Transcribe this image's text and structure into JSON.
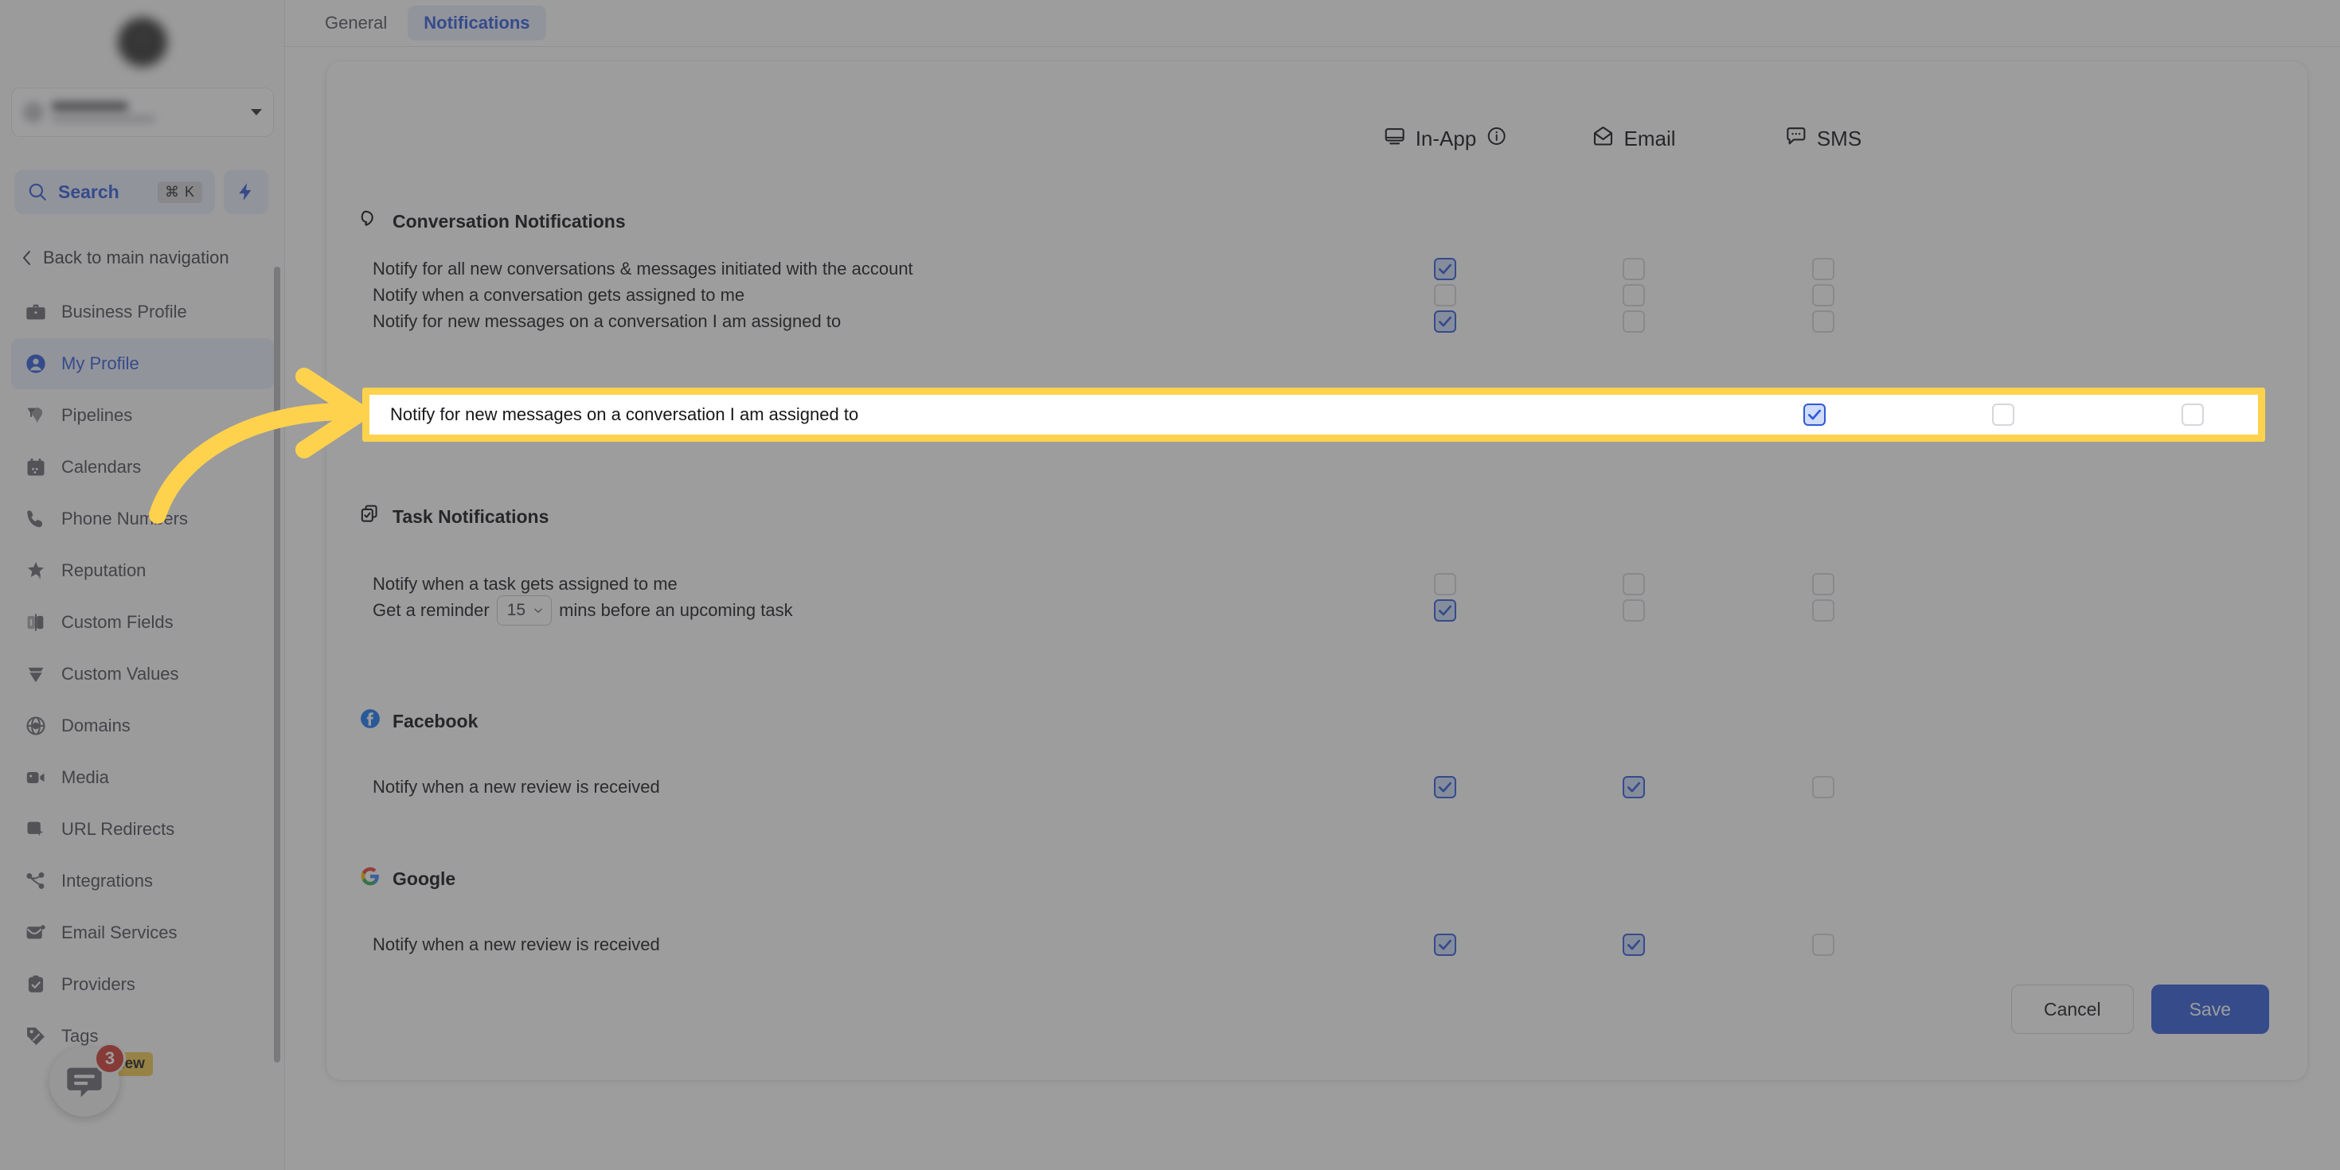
{
  "sidebar": {
    "account_switcher": {
      "name_hidden": true
    },
    "search": {
      "label": "Search",
      "shortcut": "⌘ K"
    },
    "back_nav": {
      "label": "Back to main navigation",
      "icon": "chevron-left-icon"
    },
    "items": [
      {
        "label": "Business Profile",
        "icon": "briefcase-icon",
        "active": false
      },
      {
        "label": "My Profile",
        "icon": "user-circle-icon",
        "active": true
      },
      {
        "label": "Pipelines",
        "icon": "funnel-icon",
        "active": false
      },
      {
        "label": "Calendars",
        "icon": "calendar-icon",
        "active": false
      },
      {
        "label": "Phone Numbers",
        "icon": "phone-icon",
        "active": false
      },
      {
        "label": "Reputation",
        "icon": "star-icon",
        "active": false
      },
      {
        "label": "Custom Fields",
        "icon": "custom-fields-icon",
        "active": false
      },
      {
        "label": "Custom Values",
        "icon": "diamond-icon",
        "active": false
      },
      {
        "label": "Domains",
        "icon": "globe-icon",
        "active": false
      },
      {
        "label": "Media",
        "icon": "video-icon",
        "active": false
      },
      {
        "label": "URL Redirects",
        "icon": "cursor-box-icon",
        "active": false
      },
      {
        "label": "Integrations",
        "icon": "share-nodes-icon",
        "active": false
      },
      {
        "label": "Email Services",
        "icon": "envelope-icon",
        "active": false
      },
      {
        "label": "Providers",
        "icon": "clipboard-check-icon",
        "active": false
      },
      {
        "label": "Tags",
        "icon": "tag-icon",
        "active": false
      }
    ],
    "chat_widget": {
      "count": "3",
      "new_label": "new",
      "icon": "chat-bubble-icon"
    }
  },
  "tabs": [
    {
      "label": "General",
      "active": false
    },
    {
      "label": "Notifications",
      "active": true
    }
  ],
  "columns": [
    {
      "label": "In-App",
      "icon": "monitor-icon",
      "info_icon": "info-circle-icon"
    },
    {
      "label": "Email",
      "icon": "envelope-open-icon"
    },
    {
      "label": "SMS",
      "icon": "sms-bubble-icon"
    }
  ],
  "sections": [
    {
      "title": "Conversation Notifications",
      "icon": "speech-bubble-icon",
      "rows": [
        {
          "label": "Notify for all new conversations & messages initiated with the account",
          "in_app": true,
          "email": false,
          "sms": false
        },
        {
          "label": "Notify when a conversation gets assigned to me",
          "in_app": false,
          "email": false,
          "sms": false
        },
        {
          "label": "Notify for new messages on a conversation I am assigned to",
          "in_app": true,
          "email": false,
          "sms": false,
          "highlighted": true
        }
      ]
    },
    {
      "title": "Task Notifications",
      "icon": "copy-check-icon",
      "rows": [
        {
          "label": "Notify when a task gets assigned to me",
          "in_app": false,
          "email": false,
          "sms": false
        },
        {
          "label_before": "Get a reminder",
          "select_value": "15",
          "label_after": "mins before an upcoming task",
          "in_app": true,
          "email": false,
          "sms": false
        }
      ]
    },
    {
      "title": "Facebook",
      "icon": "facebook-icon",
      "rows": [
        {
          "label": "Notify when a new review is received",
          "in_app": true,
          "email": true,
          "sms": false
        }
      ]
    },
    {
      "title": "Google",
      "icon": "google-icon",
      "rows": [
        {
          "label": "Notify when a new review is received",
          "in_app": true,
          "email": true,
          "sms": false
        }
      ]
    }
  ],
  "footer": {
    "cancel_label": "Cancel",
    "save_label": "Save"
  },
  "annotation": {
    "arrow_color": "#ffd24d",
    "highlight_color": "#ffd24d"
  }
}
